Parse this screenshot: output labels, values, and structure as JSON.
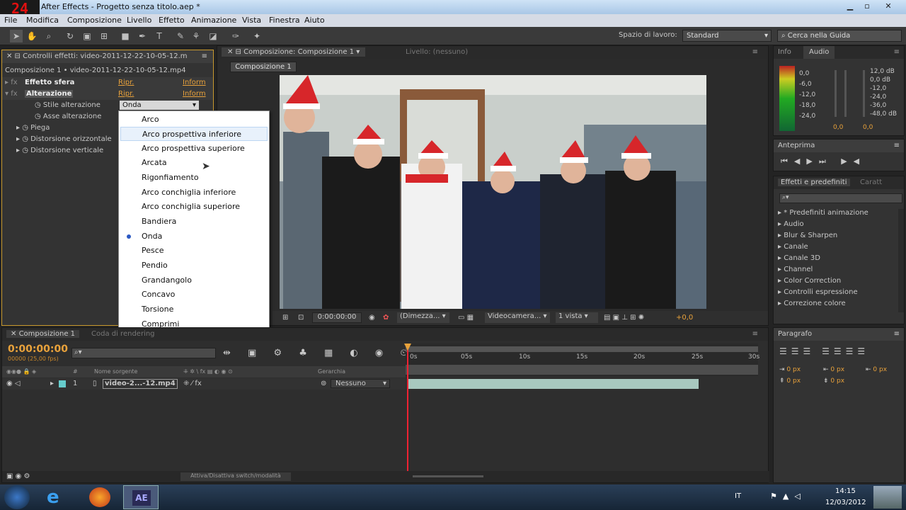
{
  "titlebar": {
    "logo": "24",
    "title": "After Effects - Progetto senza titolo.aep *"
  },
  "menubar": {
    "items": [
      "File",
      "Modifica",
      "Composizione",
      "Livello",
      "Effetto",
      "Animazione",
      "Vista",
      "Finestra",
      "Aiuto"
    ]
  },
  "toolbar": {
    "workspace_label": "Spazio di lavoro:",
    "workspace_value": "Standard",
    "search_placeholder": "Cerca nella Guida"
  },
  "effects_panel": {
    "tab": "Controlli effetti: video-2011-12-22-10-05-12.m",
    "breadcrumb": "Composizione 1 • video-2011-12-22-10-05-12.mp4",
    "effects": [
      {
        "name": "Effetto sfera",
        "reset": "Ripr.",
        "info": "Inform"
      },
      {
        "name": "Alterazione",
        "reset": "Ripr.",
        "info": "Inform"
      }
    ],
    "props": [
      "Stile alterazione",
      "Asse alterazione",
      "Piega",
      "Distorsione orizzontale",
      "Distorsione verticale"
    ],
    "style_value": "Onda"
  },
  "dropdown": {
    "items": [
      "Arco",
      "Arco prospettiva inferiore",
      "Arco prospettiva superiore",
      "Arcata",
      "Rigonfiamento",
      "Arco conchiglia inferiore",
      "Arco conchiglia superiore",
      "Bandiera",
      "Onda",
      "Pesce",
      "Pendio",
      "Grandangolo",
      "Concavo",
      "Torsione",
      "Comprimi"
    ],
    "highlighted": "Arco prospettiva inferiore",
    "selected": "Onda"
  },
  "comp_panel": {
    "tab": "Composizione: Composizione 1",
    "layer_tab": "Livello: (nessuno)",
    "subtab": "Composizione 1",
    "time": "0:00:00:00",
    "resolution": "(Dimezza...",
    "camera": "Videocamera...",
    "views": "1 vista",
    "exposure": "+0,0"
  },
  "info_panel": {
    "tabs": [
      "Info",
      "Audio"
    ],
    "left_scale": [
      "0,0",
      "-6,0",
      "-12,0",
      "-18,0",
      "-24,0"
    ],
    "right_scale": [
      "12,0 dB",
      "0,0 dB",
      "-12,0",
      "-24,0",
      "-36,0",
      "-48,0 dB"
    ],
    "left_val": "0,0",
    "right_val": "0,0"
  },
  "preview_panel": {
    "tab": "Anteprima"
  },
  "presets_panel": {
    "tabs": [
      "Effetti e predefiniti",
      "Caratt"
    ],
    "items": [
      "* Predefiniti animazione",
      "Audio",
      "Blur & Sharpen",
      "Canale",
      "Canale 3D",
      "Channel",
      "Color Correction",
      "Controlli espressione",
      "Correzione colore"
    ]
  },
  "timeline": {
    "tabs": [
      "Composizione 1",
      "Coda di rendering"
    ],
    "time": "0:00:00:00",
    "fps": "00000 (25,00 fps)",
    "col_source": "Nome sorgente",
    "col_parent": "Gerarchia",
    "col_num": "#",
    "layer": {
      "num": "1",
      "name": "video-2...-12.mp4",
      "parent": "Nessuno"
    },
    "ruler": [
      "0s",
      "05s",
      "10s",
      "15s",
      "20s",
      "25s",
      "30s"
    ],
    "footer": "Attiva/Disattiva switch/modalità"
  },
  "paragraph_panel": {
    "tab": "Paragrafo",
    "values": [
      "0 px",
      "0 px",
      "0 px",
      "0 px",
      "0 px"
    ]
  },
  "taskbar": {
    "lang": "IT",
    "time": "14:15",
    "date": "12/03/2012",
    "app": "AE"
  },
  "colors": {
    "accent": "#e9a23b",
    "brand_ae": "#9999ff",
    "highlight": "#e8f1fb"
  }
}
